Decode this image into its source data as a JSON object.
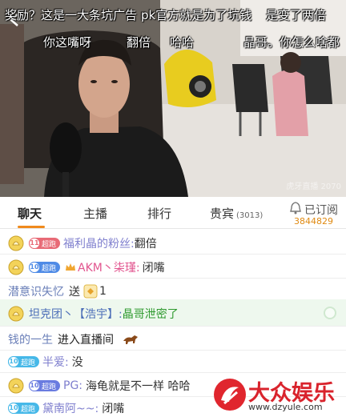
{
  "video": {
    "danmaku": [
      "奖励？这是一大条坑广告",
      "pk官方就是为了坑钱",
      "是变了两倍",
      "你这嘴呀",
      "翻倍",
      "哈哈",
      "晶哥。你怎么啥都"
    ],
    "back_icon": "back-arrow-icon",
    "watermark": "虎牙直播 2070"
  },
  "tabs": {
    "items": [
      "聊天",
      "主播",
      "排行",
      "贵宾"
    ],
    "vip_count": "(3013)",
    "active": "聊天",
    "accent": "#f08a1c"
  },
  "subscribe": {
    "label": "已订阅",
    "count": "3844829",
    "icon": "bell-icon"
  },
  "chat": {
    "rows": [
      {
        "badge_level": "11",
        "badge_text": "超跑",
        "badge_color": "red",
        "nick": "福利晶的粉丝:",
        "message": "翻倍"
      },
      {
        "badge_level": "10",
        "badge_text": "超跑",
        "badge_color": "blue",
        "nick": "AKM丶柒瑾:",
        "message": "闭嘴"
      },
      {
        "nick": "潜意识失忆",
        "action": "送",
        "gift_count": "1"
      },
      {
        "nick": "坦克团丶【浩宇】:",
        "message": "晶哥泄密了"
      },
      {
        "nick": "钱的一生",
        "action": "进入直播间"
      },
      {
        "badge_level": "10",
        "badge_text": "超跑",
        "badge_color": "cyan",
        "nick": "半爱:",
        "message": "没"
      },
      {
        "badge_level": "10",
        "badge_text": "超跑",
        "badge_color": "purple",
        "nick": "PG:",
        "message": "海龟就是不一样 哈哈"
      },
      {
        "badge_level": "10",
        "badge_text": "超跑",
        "badge_color": "cyan",
        "nick": "黛南阿~~:",
        "message": "闭嘴"
      }
    ]
  },
  "watermark": {
    "brand": "大众娱乐",
    "url": "www.dzyule.com"
  }
}
